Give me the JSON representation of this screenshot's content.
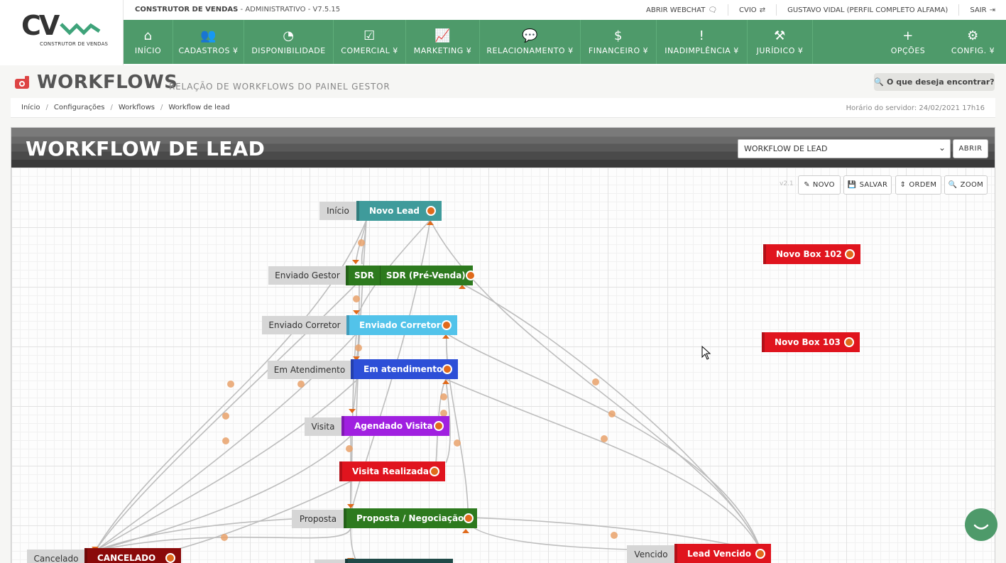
{
  "app": {
    "name": "CONSTRUTOR DE VENDAS",
    "suffix": " - ADMINISTRATIVO - V7.5.15",
    "logo_text": "CV",
    "logo_sub": "CONSTRUTOR DE VENDAS"
  },
  "top_links": [
    {
      "label": "ABRIR WEBCHAT",
      "icon": "chat-icon",
      "glyph": "🗨"
    },
    {
      "label": "CVIO",
      "icon": "swap-icon",
      "glyph": "⇄"
    },
    {
      "label": "GUSTAVO VIDAL (PERFIL COMPLETO ALFAMA)",
      "icon": "",
      "glyph": ""
    },
    {
      "label": "SAIR",
      "icon": "logout-icon",
      "glyph": "⇥"
    }
  ],
  "nav": [
    {
      "label": "INÍCIO",
      "icon": "home-icon",
      "glyph": "⌂"
    },
    {
      "label": "CADASTROS ¥",
      "icon": "users-icon",
      "glyph": "👥"
    },
    {
      "label": "DISPONIBILIDADE",
      "icon": "dashboard-icon",
      "glyph": "◔"
    },
    {
      "label": "COMERCIAL ¥",
      "icon": "checkbox-icon",
      "glyph": "☑"
    },
    {
      "label": "MARKETING ¥",
      "icon": "chart-icon",
      "glyph": "📈"
    },
    {
      "label": "RELACIONAMENTO ¥",
      "icon": "comments-icon",
      "glyph": "💬"
    },
    {
      "label": "FINANCEIRO ¥",
      "icon": "dollar-icon",
      "glyph": "$"
    },
    {
      "label": "INADIMPLÊNCIA ¥",
      "icon": "alert-icon",
      "glyph": "!"
    },
    {
      "label": "JURÍDICO ¥",
      "icon": "gavel-icon",
      "glyph": "⚒"
    },
    {
      "label": "OPÇÕES",
      "icon": "plus-icon",
      "glyph": "+"
    },
    {
      "label": "CONFIG. ¥",
      "icon": "gear-icon",
      "glyph": "⚙"
    }
  ],
  "page": {
    "title": "WORKFLOWS",
    "subtitle": "RELAÇÃO DE WORKFLOWS DO PAINEL GESTOR",
    "search_label": "O que deseja encontrar?",
    "server_time": "Horário do servidor: 24/02/2021 17h16"
  },
  "breadcrumb": [
    "Início",
    "Configurações",
    "Workflows",
    "Workflow de lead"
  ],
  "panel": {
    "title": "WORKFLOW DE LEAD",
    "select_value": "WORKFLOW DE LEAD",
    "open_label": "ABRIR",
    "version": "v2.1",
    "tools": [
      {
        "label": "NOVO",
        "icon": "pencil-icon",
        "glyph": "✎"
      },
      {
        "label": "SALVAR",
        "icon": "save-icon",
        "glyph": "💾"
      },
      {
        "label": "ORDEM",
        "icon": "sort-icon",
        "glyph": "⇕"
      },
      {
        "label": "ZOOM",
        "icon": "zoom-icon",
        "glyph": "🔍"
      }
    ]
  },
  "colors": {
    "brand_green": "#4e9a6a",
    "teal": "#3f9b9b",
    "dark_green": "#2d7a1e",
    "light_blue": "#52c3ea",
    "blue": "#2d4fd7",
    "purple": "#a020e0",
    "red": "#e0141e",
    "dark_red": "#8a0a0a",
    "dark_teal": "#204a48",
    "dot_orange": "#e06a1b"
  },
  "nodes": [
    {
      "id": "novo-lead",
      "label": "Novo Lead",
      "side_label": "Início",
      "tag": "",
      "color": "#3f9b9b"
    },
    {
      "id": "sdr",
      "label": "SDR (Pré-Venda)",
      "side_label": "Enviado Gestor",
      "tag": "SDR",
      "color": "#2d7a1e"
    },
    {
      "id": "enviado-corretor",
      "label": "Enviado Corretor",
      "side_label": "Enviado Corretor",
      "tag": "",
      "color": "#52c3ea"
    },
    {
      "id": "em-atendimento",
      "label": "Em atendimento",
      "side_label": "Em Atendimento",
      "tag": "",
      "color": "#2d4fd7"
    },
    {
      "id": "agendado-visita",
      "label": "Agendado Visita",
      "side_label": "Visita",
      "tag": "",
      "color": "#a020e0"
    },
    {
      "id": "visita-realizada",
      "label": "Visita Realizada",
      "side_label": "",
      "tag": "",
      "color": "#e0141e"
    },
    {
      "id": "proposta",
      "label": "Proposta / Negociação",
      "side_label": "Proposta",
      "tag": "",
      "color": "#2d7a1e"
    },
    {
      "id": "cancelado",
      "label": "CANCELADO",
      "side_label": "Cancelado",
      "tag": "",
      "color": "#8a0a0a"
    },
    {
      "id": "lead-vencido",
      "label": "Lead Vencido",
      "side_label": "Vencido",
      "tag": "",
      "color": "#e0141e"
    },
    {
      "id": "box-102",
      "label": "Novo Box 102",
      "side_label": "",
      "tag": "",
      "color": "#e0141e"
    },
    {
      "id": "box-103",
      "label": "Novo Box 103",
      "side_label": "",
      "tag": "",
      "color": "#e0141e"
    },
    {
      "id": "partial",
      "label": "",
      "side_label": "",
      "tag": "",
      "color": "#204a48"
    }
  ]
}
